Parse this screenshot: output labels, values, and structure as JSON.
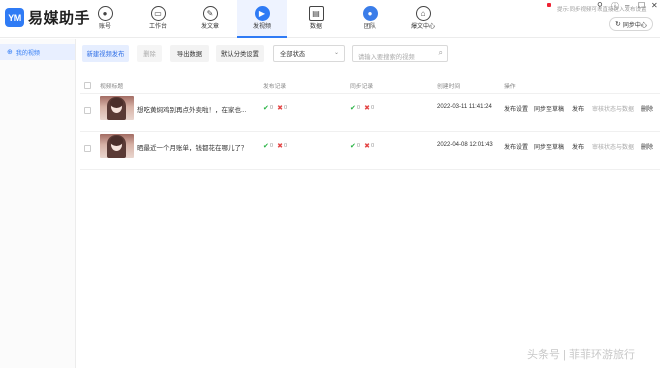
{
  "app": {
    "name": "易媒助手",
    "logo_mark": "YM",
    "brand_color": "#2f7bf5"
  },
  "nav": {
    "items": [
      {
        "label": "账号",
        "icon": "user-icon"
      },
      {
        "label": "工作台",
        "icon": "monitor-icon"
      },
      {
        "label": "发文章",
        "icon": "pen-icon"
      },
      {
        "label": "发视频",
        "icon": "play-icon"
      },
      {
        "label": "数据",
        "icon": "chart-icon"
      },
      {
        "label": "团队",
        "icon": "team-icon"
      },
      {
        "label": "爆文中心",
        "icon": "home-icon"
      }
    ],
    "active": "发视频"
  },
  "window": {
    "sync_label": "同步中心"
  },
  "sidebar": {
    "items": [
      {
        "label": "我的视频"
      }
    ]
  },
  "toolbar": {
    "new_label": "新建视频发布",
    "delete_label": "删除",
    "export_label": "导出数据",
    "category_label": "默认分类设置",
    "status_select": "全部状态",
    "search_placeholder": "请输入要搜索的视频",
    "hint": "提示:同步视频可以直接进入发布设置"
  },
  "table": {
    "headers": {
      "title": "视频标题",
      "publish": "发布记录",
      "sync": "同步记录",
      "created": "创建时间",
      "ops": "操作"
    },
    "rows": [
      {
        "title": "想吃黄焖鸡别再点外卖啦！，在家也...",
        "publish_ok": "0",
        "publish_fail": "0",
        "sync_ok": "0",
        "sync_fail": "0",
        "created": "2022-03-11 11:41:24",
        "op_settings": "发布设置",
        "op_sync": "同步至草稿",
        "op_publish": "发布",
        "op_status": "审核状态与数据",
        "op_delete": "删除"
      },
      {
        "title": "晒最近一个月账单，钱都花在哪儿了？",
        "publish_ok": "0",
        "publish_fail": "0",
        "sync_ok": "0",
        "sync_fail": "0",
        "created": "2022-04-08 12:01:43",
        "op_settings": "发布设置",
        "op_sync": "同步至草稿",
        "op_publish": "发布",
        "op_status": "审核状态与数据",
        "op_delete": "删除"
      }
    ]
  },
  "watermark": "头条号 | 菲菲环游旅行"
}
